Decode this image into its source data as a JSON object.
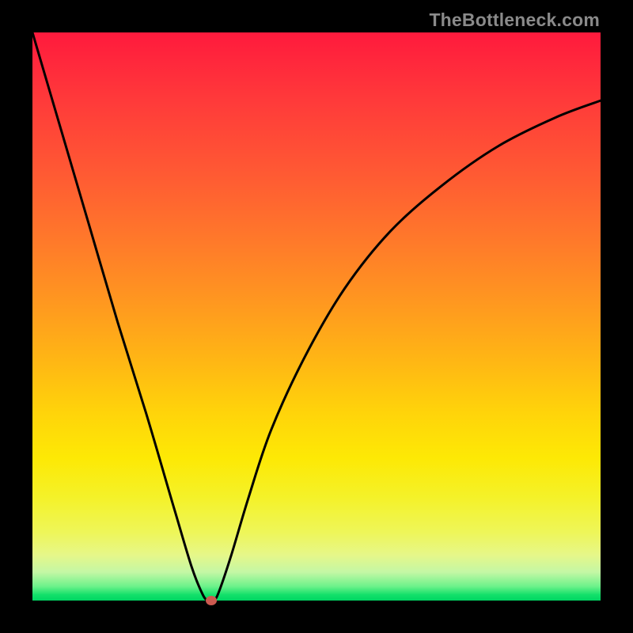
{
  "watermark": "TheBottleneck.com",
  "chart_data": {
    "type": "line",
    "title": "",
    "xlabel": "",
    "ylabel": "",
    "xlim": [
      0,
      100
    ],
    "ylim": [
      0,
      100
    ],
    "series": [
      {
        "name": "bottleneck-curve",
        "x": [
          0,
          5,
          10,
          15,
          20,
          25,
          28,
          30,
          31,
          32,
          33,
          35,
          38,
          42,
          48,
          55,
          63,
          72,
          82,
          92,
          100
        ],
        "values": [
          100,
          83,
          66,
          49,
          33,
          16,
          6,
          1,
          0,
          0,
          2,
          8,
          18,
          30,
          43,
          55,
          65,
          73,
          80,
          85,
          88
        ]
      }
    ],
    "marker": {
      "x": 31.5,
      "y": 0
    },
    "background_gradient": {
      "top": "#ff1a3d",
      "mid": "#ffd40a",
      "bottom": "#00d563"
    }
  }
}
